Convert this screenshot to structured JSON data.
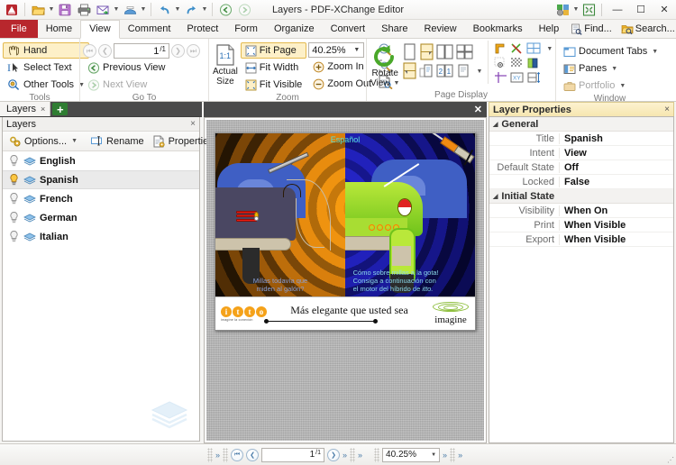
{
  "titlebar": {
    "title": "Layers - PDF-XChange Editor",
    "quick_access": [
      {
        "name": "app-logo-icon",
        "label": "PDF-XChange"
      },
      {
        "name": "open-icon",
        "label": "Open"
      },
      {
        "name": "save-icon",
        "label": "Save"
      },
      {
        "name": "print-icon",
        "label": "Print"
      },
      {
        "name": "email-icon",
        "label": "Email"
      },
      {
        "name": "scan-icon",
        "label": "Scan"
      },
      {
        "name": "undo-icon",
        "label": "Undo"
      },
      {
        "name": "redo-icon",
        "label": "Redo"
      },
      {
        "name": "back-icon",
        "label": "Previous View"
      },
      {
        "name": "forward-icon",
        "label": "Next View"
      }
    ],
    "right_icons": [
      {
        "name": "customize-icon",
        "label": "Customize"
      },
      {
        "name": "fullscreen-icon",
        "label": "Full Screen"
      }
    ],
    "window_buttons": {
      "minimize": "—",
      "maximize": "☐",
      "close": "✕"
    }
  },
  "tabs": {
    "file_label": "File",
    "items": [
      "Home",
      "View",
      "Comment",
      "Protect",
      "Form",
      "Organize",
      "Convert",
      "Share",
      "Review",
      "Bookmarks",
      "Help"
    ],
    "active": "View",
    "right_buttons": [
      {
        "name": "find-button",
        "label": "Find..."
      },
      {
        "name": "search-button",
        "label": "Search..."
      }
    ],
    "collapse_glyph": "⌃"
  },
  "ribbon": {
    "groups": [
      {
        "name": "tools",
        "label": "Tools",
        "buttons": [
          {
            "name": "hand-tool",
            "label": "Hand",
            "selected": true
          },
          {
            "name": "select-text-tool",
            "label": "Select Text",
            "selected": false
          },
          {
            "name": "other-tools",
            "label": "Other Tools",
            "selected": false,
            "caret": true
          }
        ]
      },
      {
        "name": "goto",
        "label": "Go To",
        "page_value": "1",
        "page_total": "1",
        "buttons": [
          {
            "name": "previous-view-button",
            "label": "Previous View",
            "disabled": false
          },
          {
            "name": "next-view-button",
            "label": "Next View",
            "disabled": true
          }
        ],
        "nav": [
          {
            "name": "first-page-button",
            "glyph": "⏮",
            "disabled": true
          },
          {
            "name": "previous-page-button",
            "glyph": "❮",
            "disabled": true
          },
          {
            "name": "next-page-button",
            "glyph": "❯",
            "disabled": true
          },
          {
            "name": "last-page-button",
            "glyph": "⏭",
            "disabled": true
          }
        ]
      },
      {
        "name": "zoom",
        "label": "Zoom",
        "actual_size_label": "Actual\nSize",
        "actual_size_line1": "Actual",
        "actual_size_line2": "Size",
        "actual_size_badge": "1:1",
        "zoom_value": "40.25%",
        "buttons": [
          {
            "name": "fit-page-button",
            "label": "Fit Page",
            "selected": true
          },
          {
            "name": "fit-width-button",
            "label": "Fit Width",
            "selected": false
          },
          {
            "name": "fit-visible-button",
            "label": "Fit Visible",
            "selected": false
          },
          {
            "name": "zoom-in-button",
            "label": "Zoom In",
            "selected": false
          },
          {
            "name": "zoom-out-button",
            "label": "Zoom Out",
            "selected": false
          }
        ]
      },
      {
        "name": "page-display",
        "label": "Page Display",
        "rotate_line1": "Rotate",
        "rotate_line2": "View",
        "icons": [
          "single-page-icon",
          "single-page-continuous-icon",
          "two-page-icon",
          "two-page-continuous-icon",
          "scroll-icon",
          "cover-page-icon",
          "page-numbers-icon",
          "text-flow-icon",
          "crop-marks-icon",
          "split-view-icon",
          "grid-icon",
          "snap-to-grid-icon",
          "transparency-grid-icon",
          "color-profile-icon",
          "guides-icon",
          "coordinates-icon",
          "measure-icon"
        ]
      },
      {
        "name": "window",
        "label": "Window",
        "buttons": [
          {
            "name": "document-tabs-button",
            "label": "Document Tabs",
            "disabled": false,
            "caret": true
          },
          {
            "name": "panes-button",
            "label": "Panes",
            "disabled": false,
            "caret": true
          },
          {
            "name": "portfolio-button",
            "label": "Portfolio",
            "disabled": true,
            "caret": true
          }
        ]
      }
    ]
  },
  "left_panel": {
    "tab_label": "Layers",
    "tab_close": "×",
    "add_tab_glyph": "+",
    "header_title": "Layers",
    "header_close": "×",
    "toolbar": [
      {
        "name": "options-button",
        "label": "Options...",
        "icon": "gear-icon",
        "caret": true
      },
      {
        "name": "rename-button",
        "label": "Rename",
        "icon": "rename-icon",
        "caret": false
      },
      {
        "name": "properties-button",
        "label": "Properties...",
        "icon": "properties-icon",
        "caret": false
      }
    ],
    "layers": [
      {
        "name": "English",
        "visible": false
      },
      {
        "name": "Spanish",
        "visible": true
      },
      {
        "name": "French",
        "visible": false
      },
      {
        "name": "German",
        "visible": false
      },
      {
        "name": "Italian",
        "visible": false
      }
    ],
    "selected_layer": "Spanish",
    "watermark_icon": "layers-watermark-icon"
  },
  "document": {
    "close_glyph": "✕",
    "page": {
      "language_label": "Español",
      "caption_left_line1": "Millas todavía que",
      "caption_left_line2": "miden al galón?",
      "caption_right_line1": "Cómo sobre millas a la gota!",
      "caption_right_line2": "Consiga a continuación con",
      "caption_right_line3a": "el motor del híbrido de ",
      "caption_right_line3b": "itto.",
      "banner_logo_letters": [
        "i",
        "t",
        "t",
        "o"
      ],
      "banner_logo_tagline": "imagine la conexión",
      "banner_slogan": "Más elegante que usted sea",
      "banner_right_word": "imagine"
    }
  },
  "right_panel": {
    "header_title": "Layer Properties",
    "header_close": "×",
    "groups": [
      {
        "name": "General",
        "rows": [
          {
            "key": "Title",
            "value": "Spanish"
          },
          {
            "key": "Intent",
            "value": "View"
          },
          {
            "key": "Default State",
            "value": "Off"
          },
          {
            "key": "Locked",
            "value": "False"
          }
        ]
      },
      {
        "name": "Initial State",
        "rows": [
          {
            "key": "Visibility",
            "value": "When On"
          },
          {
            "key": "Print",
            "value": "When Visible"
          },
          {
            "key": "Export",
            "value": "When Visible"
          }
        ]
      }
    ]
  },
  "statusbar": {
    "page_value": "1",
    "page_total": "1",
    "zoom_value": "40.25%",
    "nav": [
      {
        "name": "first-page-button",
        "glyph": "⏮"
      },
      {
        "name": "previous-page-button",
        "glyph": "❮"
      },
      {
        "name": "next-page-button",
        "glyph": "❯"
      }
    ],
    "chevron_glyph": "»"
  },
  "colors": {
    "accent_red": "#b8272d",
    "accent_gold": "#f5a21a",
    "panel_header": "#f6e6b0",
    "canvas_gray": "#b3b3b3",
    "dark_bar": "#4a4a4a"
  }
}
